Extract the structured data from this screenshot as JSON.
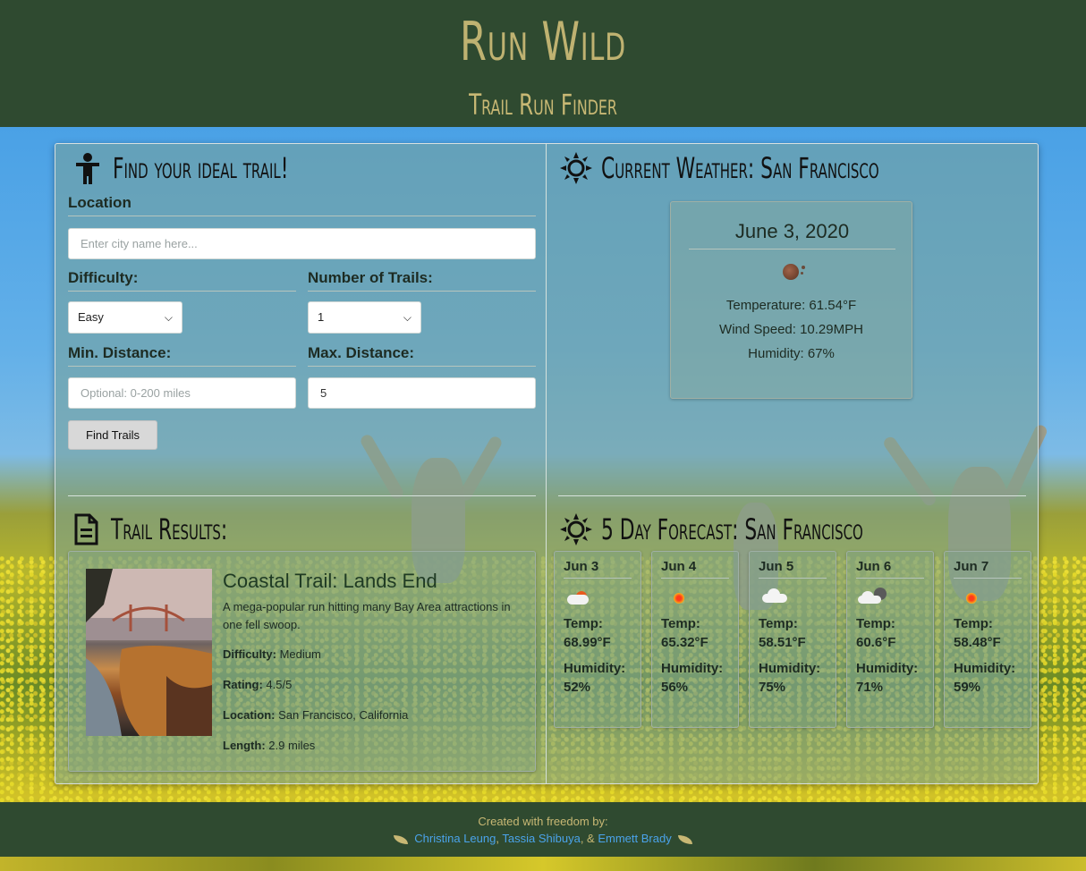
{
  "header": {
    "title": "Run Wild",
    "subtitle": "Trail Run Finder"
  },
  "search": {
    "title": "Find your ideal trail!",
    "location_label": "Location",
    "location_placeholder": "Enter city name here...",
    "difficulty_label": "Difficulty:",
    "difficulty_value": "Easy",
    "num_trails_label": "Number of Trails:",
    "num_trails_value": "1",
    "min_distance_label": "Min. Distance:",
    "min_distance_placeholder": "Optional: 0-200 miles",
    "max_distance_label": "Max. Distance:",
    "max_distance_value": "5",
    "find_button": "Find Trails"
  },
  "weather": {
    "title": "Current Weather: San Francisco",
    "date": "June 3, 2020",
    "temperature": "Temperature: 61.54°F",
    "wind": "Wind Speed: 10.29MPH",
    "humidity": "Humidity: 67%"
  },
  "results": {
    "title": "Trail Results:",
    "trail": {
      "name": "Coastal Trail: Lands End",
      "description": "A mega-popular run hitting many Bay Area attractions in one fell swoop.",
      "difficulty_label": "Difficulty:",
      "difficulty": "Medium",
      "rating_label": "Rating:",
      "rating": "4.5/5",
      "location_label": "Location:",
      "location": "San Francisco, California",
      "length_label": "Length:",
      "length": "2.9 miles"
    }
  },
  "forecast": {
    "title": "5 Day Forecast: San Francisco",
    "temp_label": "Temp:",
    "humidity_label": "Humidity:",
    "days": [
      {
        "date": "Jun 3",
        "temp": "68.99°F",
        "humidity": "52%",
        "icon": "partly-sunny-icon"
      },
      {
        "date": "Jun 4",
        "temp": "65.32°F",
        "humidity": "56%",
        "icon": "sun-icon"
      },
      {
        "date": "Jun 5",
        "temp": "58.51°F",
        "humidity": "75%",
        "icon": "cloud-icon"
      },
      {
        "date": "Jun 6",
        "temp": "60.6°F",
        "humidity": "71%",
        "icon": "dark-cloud-icon"
      },
      {
        "date": "Jun 7",
        "temp": "58.48°F",
        "humidity": "59%",
        "icon": "sun-icon"
      }
    ]
  },
  "footer": {
    "line1": "Created with freedom by:",
    "author1": "Christina Leung",
    "sep1": ",",
    "author2": "Tassia Shibuya",
    "sep2": ", &",
    "author3": "Emmett Brady"
  },
  "colors": {
    "header_bg": "#2f4a30",
    "title_gold": "#bfb271",
    "link_blue": "#4aa3ea"
  }
}
